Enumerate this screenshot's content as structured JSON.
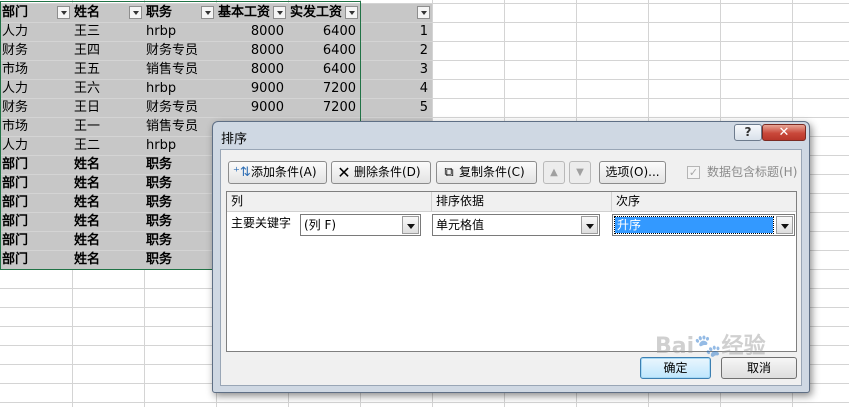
{
  "spreadsheet": {
    "headers": [
      "部门",
      "姓名",
      "职务",
      "基本工资",
      "实发工资",
      ""
    ],
    "rows": [
      {
        "dept": "人力",
        "name": "王三",
        "role": "hrbp",
        "base": "8000",
        "paid": "6400",
        "f": "1"
      },
      {
        "dept": "财务",
        "name": "王四",
        "role": "财务专员",
        "base": "8000",
        "paid": "6400",
        "f": "2"
      },
      {
        "dept": "市场",
        "name": "王五",
        "role": "销售专员",
        "base": "8000",
        "paid": "6400",
        "f": "3"
      },
      {
        "dept": "人力",
        "name": "王六",
        "role": "hrbp",
        "base": "9000",
        "paid": "7200",
        "f": "4"
      },
      {
        "dept": "财务",
        "name": "王日",
        "role": "财务专员",
        "base": "9000",
        "paid": "7200",
        "f": "5"
      },
      {
        "dept": "市场",
        "name": "王一",
        "role": "销售专员",
        "base": "",
        "paid": "",
        "f": ""
      },
      {
        "dept": "人力",
        "name": "王二",
        "role": "hrbp",
        "base": "",
        "paid": "",
        "f": ""
      },
      {
        "dept": "部门",
        "name": "姓名",
        "role": "职务",
        "base": "",
        "paid": "",
        "f": ""
      },
      {
        "dept": "部门",
        "name": "姓名",
        "role": "职务",
        "base": "",
        "paid": "",
        "f": ""
      },
      {
        "dept": "部门",
        "name": "姓名",
        "role": "职务",
        "base": "",
        "paid": "",
        "f": ""
      },
      {
        "dept": "部门",
        "name": "姓名",
        "role": "职务",
        "base": "",
        "paid": "",
        "f": ""
      },
      {
        "dept": "部门",
        "name": "姓名",
        "role": "职务",
        "base": "",
        "paid": "",
        "f": ""
      },
      {
        "dept": "部门",
        "name": "姓名",
        "role": "职务",
        "base": "",
        "paid": "",
        "f": ""
      }
    ]
  },
  "dialog": {
    "title": "排序",
    "help_label": "?",
    "close_label": "✕",
    "toolbar": {
      "add_label": "添加条件(A)",
      "delete_label": "删除条件(D)",
      "copy_label": "复制条件(C)",
      "up_label": "▲",
      "down_label": "▼",
      "options_label": "选项(O)...",
      "has_header_label": "数据包含标题(H)",
      "has_header_checked": true
    },
    "grid": {
      "col_header": "列",
      "sort_on_header": "排序依据",
      "order_header": "次序",
      "row_label": "主要关键字",
      "column_value": "(列 F)",
      "sort_on_value": "单元格值",
      "order_value": "升序"
    },
    "ok_label": "确定",
    "cancel_label": "取消"
  },
  "watermark": "Bai 经验"
}
